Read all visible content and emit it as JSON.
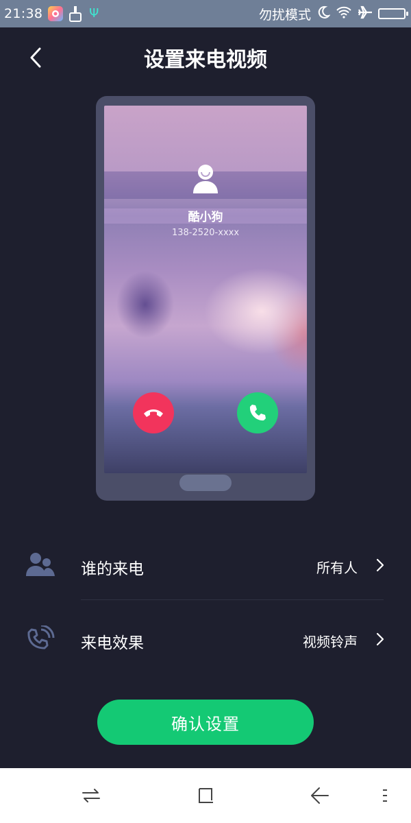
{
  "status_bar": {
    "time": "21:38",
    "dnd_label": "勿扰模式",
    "icons": [
      "app-icon",
      "brush-icon",
      "usb-icon",
      "moon-icon",
      "wifi-icon",
      "airplane-icon",
      "battery-icon"
    ]
  },
  "header": {
    "title": "设置来电视频",
    "back_icon": "chevron-left-icon"
  },
  "preview": {
    "caller_name": "酷小狗",
    "caller_number": "138-2520-xxxx",
    "decline_icon": "phone-hangup-icon",
    "accept_icon": "phone-icon",
    "decline_color": "#f2345c",
    "accept_color": "#22d07a"
  },
  "settings": {
    "rows": [
      {
        "label": "谁的来电",
        "value": "所有人",
        "icon": "contacts-icon"
      },
      {
        "label": "来电效果",
        "value": "视频铃声",
        "icon": "phone-ringing-icon"
      }
    ]
  },
  "confirm_button": {
    "label": "确认设置",
    "color": "#14c974"
  },
  "nav_bar": {
    "icons": [
      "switch-apps-icon",
      "home-square-icon",
      "back-arrow-icon",
      "menu-icon"
    ]
  },
  "colors": {
    "background": "#1e1f2e",
    "status_bar": "#6f7f97",
    "phone_frame": "#4b4e68"
  }
}
